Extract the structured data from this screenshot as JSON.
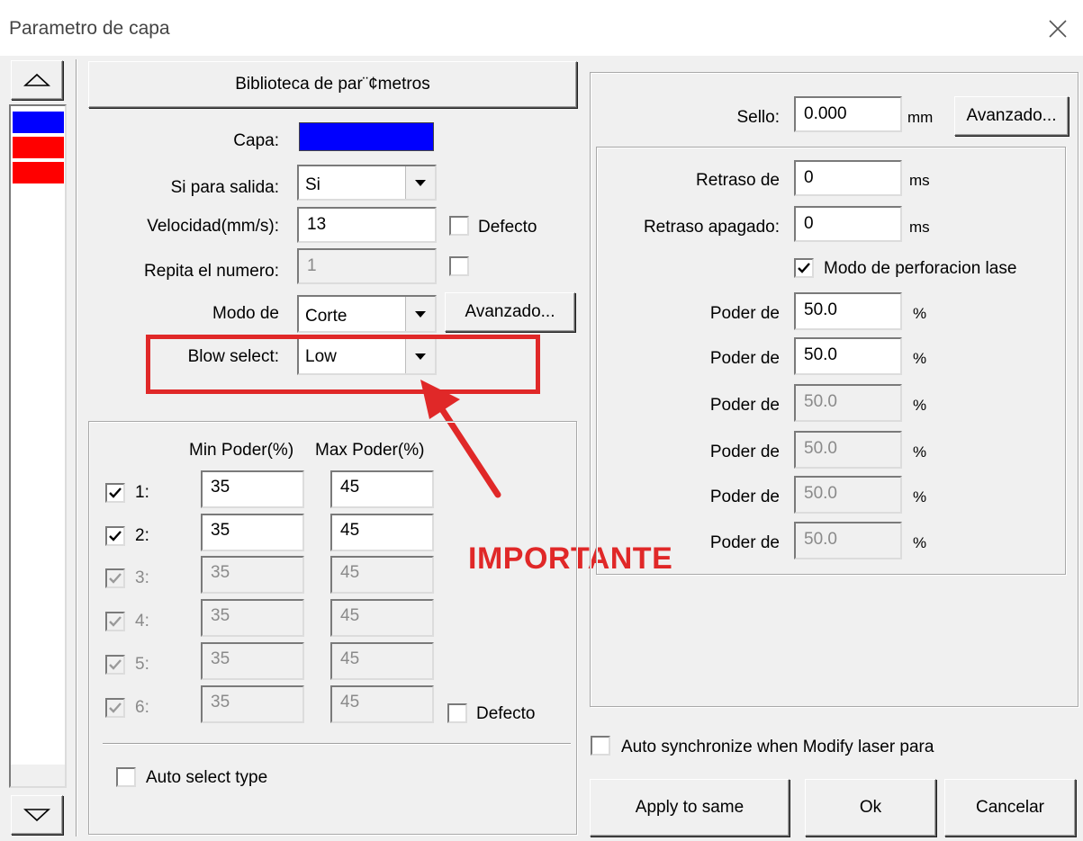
{
  "window": {
    "title": "Parametro de capa"
  },
  "layers": {
    "colors": [
      "#0000ff",
      "#ff0000",
      "#ff0000"
    ]
  },
  "library_button": "Biblioteca de par¨¢metros",
  "form": {
    "capa_label": "Capa:",
    "capa_color": "#0000ff",
    "salida_label": "Si para salida:",
    "salida_value": "Si",
    "velocidad_label": "Velocidad(mm/s):",
    "velocidad_value": "13",
    "velocidad_default": "Defecto",
    "repita_label": "Repita el numero:",
    "repita_value": "1",
    "modo_label": "Modo de",
    "modo_value": "Corte",
    "advanced_button": "Avanzado...",
    "blow_label": "Blow select:",
    "blow_value": "Low"
  },
  "annotation": {
    "text": "IMPORTANTE",
    "color": "#e02828"
  },
  "power": {
    "min_header": "Min Poder(%)",
    "max_header": "Max Poder(%)",
    "rows": [
      {
        "label": "1:",
        "min": "35",
        "max": "45",
        "enabled": true
      },
      {
        "label": "2:",
        "min": "35",
        "max": "45",
        "enabled": true
      },
      {
        "label": "3:",
        "min": "35",
        "max": "45",
        "enabled": false
      },
      {
        "label": "4:",
        "min": "35",
        "max": "45",
        "enabled": false
      },
      {
        "label": "5:",
        "min": "35",
        "max": "45",
        "enabled": false
      },
      {
        "label": "6:",
        "min": "35",
        "max": "45",
        "enabled": false
      }
    ],
    "default_label": "Defecto",
    "auto_select": "Auto select type"
  },
  "right": {
    "sello_label": "Sello:",
    "sello_value": "0.000",
    "sello_unit": "mm",
    "advanced_button": "Avanzado...",
    "retraso_label": "Retraso de",
    "retraso_value": "0",
    "retraso_unit": "ms",
    "apagado_label": "Retraso apagado:",
    "apagado_value": "0",
    "apagado_unit": "ms",
    "perforacion_label": "Modo de perforacion lase",
    "poder": [
      {
        "label": "Poder de",
        "value": "50.0",
        "unit": "%",
        "enabled": true
      },
      {
        "label": "Poder de",
        "value": "50.0",
        "unit": "%",
        "enabled": true
      },
      {
        "label": "Poder de",
        "value": "50.0",
        "unit": "%",
        "enabled": false
      },
      {
        "label": "Poder de",
        "value": "50.0",
        "unit": "%",
        "enabled": false
      },
      {
        "label": "Poder de",
        "value": "50.0",
        "unit": "%",
        "enabled": false
      },
      {
        "label": "Poder de",
        "value": "50.0",
        "unit": "%",
        "enabled": false
      }
    ],
    "auto_sync": "Auto synchronize when Modify laser para"
  },
  "buttons": {
    "apply": "Apply to same",
    "ok": "Ok",
    "cancel": "Cancelar"
  }
}
